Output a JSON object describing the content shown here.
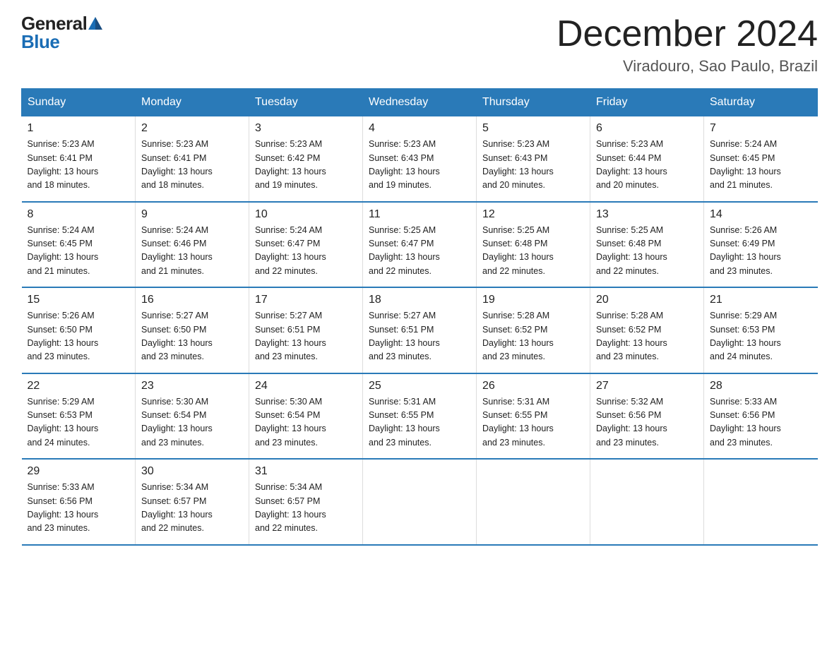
{
  "header": {
    "logo_general": "General",
    "logo_blue": "Blue",
    "title": "December 2024",
    "subtitle": "Viradouro, Sao Paulo, Brazil"
  },
  "calendar": {
    "days_of_week": [
      "Sunday",
      "Monday",
      "Tuesday",
      "Wednesday",
      "Thursday",
      "Friday",
      "Saturday"
    ],
    "weeks": [
      [
        {
          "num": "1",
          "sunrise": "5:23 AM",
          "sunset": "6:41 PM",
          "daylight_h": "13",
          "daylight_m": "18"
        },
        {
          "num": "2",
          "sunrise": "5:23 AM",
          "sunset": "6:41 PM",
          "daylight_h": "13",
          "daylight_m": "18"
        },
        {
          "num": "3",
          "sunrise": "5:23 AM",
          "sunset": "6:42 PM",
          "daylight_h": "13",
          "daylight_m": "19"
        },
        {
          "num": "4",
          "sunrise": "5:23 AM",
          "sunset": "6:43 PM",
          "daylight_h": "13",
          "daylight_m": "19"
        },
        {
          "num": "5",
          "sunrise": "5:23 AM",
          "sunset": "6:43 PM",
          "daylight_h": "13",
          "daylight_m": "20"
        },
        {
          "num": "6",
          "sunrise": "5:23 AM",
          "sunset": "6:44 PM",
          "daylight_h": "13",
          "daylight_m": "20"
        },
        {
          "num": "7",
          "sunrise": "5:24 AM",
          "sunset": "6:45 PM",
          "daylight_h": "13",
          "daylight_m": "21"
        }
      ],
      [
        {
          "num": "8",
          "sunrise": "5:24 AM",
          "sunset": "6:45 PM",
          "daylight_h": "13",
          "daylight_m": "21"
        },
        {
          "num": "9",
          "sunrise": "5:24 AM",
          "sunset": "6:46 PM",
          "daylight_h": "13",
          "daylight_m": "21"
        },
        {
          "num": "10",
          "sunrise": "5:24 AM",
          "sunset": "6:47 PM",
          "daylight_h": "13",
          "daylight_m": "22"
        },
        {
          "num": "11",
          "sunrise": "5:25 AM",
          "sunset": "6:47 PM",
          "daylight_h": "13",
          "daylight_m": "22"
        },
        {
          "num": "12",
          "sunrise": "5:25 AM",
          "sunset": "6:48 PM",
          "daylight_h": "13",
          "daylight_m": "22"
        },
        {
          "num": "13",
          "sunrise": "5:25 AM",
          "sunset": "6:48 PM",
          "daylight_h": "13",
          "daylight_m": "22"
        },
        {
          "num": "14",
          "sunrise": "5:26 AM",
          "sunset": "6:49 PM",
          "daylight_h": "13",
          "daylight_m": "23"
        }
      ],
      [
        {
          "num": "15",
          "sunrise": "5:26 AM",
          "sunset": "6:50 PM",
          "daylight_h": "13",
          "daylight_m": "23"
        },
        {
          "num": "16",
          "sunrise": "5:27 AM",
          "sunset": "6:50 PM",
          "daylight_h": "13",
          "daylight_m": "23"
        },
        {
          "num": "17",
          "sunrise": "5:27 AM",
          "sunset": "6:51 PM",
          "daylight_h": "13",
          "daylight_m": "23"
        },
        {
          "num": "18",
          "sunrise": "5:27 AM",
          "sunset": "6:51 PM",
          "daylight_h": "13",
          "daylight_m": "23"
        },
        {
          "num": "19",
          "sunrise": "5:28 AM",
          "sunset": "6:52 PM",
          "daylight_h": "13",
          "daylight_m": "23"
        },
        {
          "num": "20",
          "sunrise": "5:28 AM",
          "sunset": "6:52 PM",
          "daylight_h": "13",
          "daylight_m": "23"
        },
        {
          "num": "21",
          "sunrise": "5:29 AM",
          "sunset": "6:53 PM",
          "daylight_h": "13",
          "daylight_m": "24"
        }
      ],
      [
        {
          "num": "22",
          "sunrise": "5:29 AM",
          "sunset": "6:53 PM",
          "daylight_h": "13",
          "daylight_m": "24"
        },
        {
          "num": "23",
          "sunrise": "5:30 AM",
          "sunset": "6:54 PM",
          "daylight_h": "13",
          "daylight_m": "23"
        },
        {
          "num": "24",
          "sunrise": "5:30 AM",
          "sunset": "6:54 PM",
          "daylight_h": "13",
          "daylight_m": "23"
        },
        {
          "num": "25",
          "sunrise": "5:31 AM",
          "sunset": "6:55 PM",
          "daylight_h": "13",
          "daylight_m": "23"
        },
        {
          "num": "26",
          "sunrise": "5:31 AM",
          "sunset": "6:55 PM",
          "daylight_h": "13",
          "daylight_m": "23"
        },
        {
          "num": "27",
          "sunrise": "5:32 AM",
          "sunset": "6:56 PM",
          "daylight_h": "13",
          "daylight_m": "23"
        },
        {
          "num": "28",
          "sunrise": "5:33 AM",
          "sunset": "6:56 PM",
          "daylight_h": "13",
          "daylight_m": "23"
        }
      ],
      [
        {
          "num": "29",
          "sunrise": "5:33 AM",
          "sunset": "6:56 PM",
          "daylight_h": "13",
          "daylight_m": "23"
        },
        {
          "num": "30",
          "sunrise": "5:34 AM",
          "sunset": "6:57 PM",
          "daylight_h": "13",
          "daylight_m": "22"
        },
        {
          "num": "31",
          "sunrise": "5:34 AM",
          "sunset": "6:57 PM",
          "daylight_h": "13",
          "daylight_m": "22"
        },
        null,
        null,
        null,
        null
      ]
    ]
  }
}
